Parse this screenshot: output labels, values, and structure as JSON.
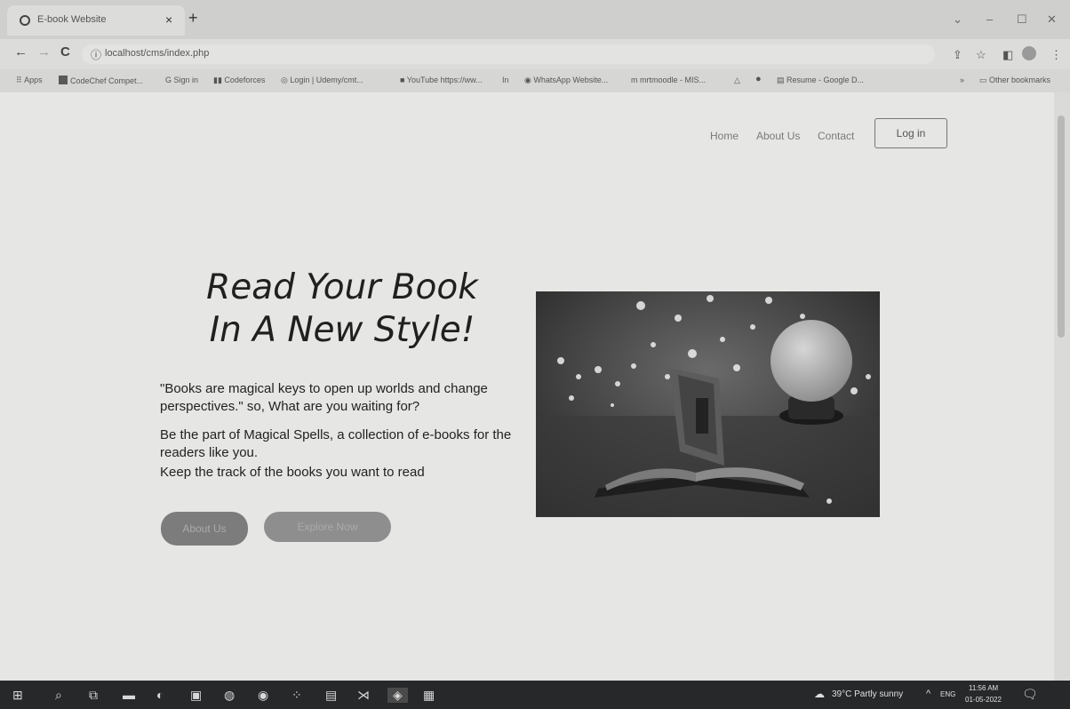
{
  "browser": {
    "tab_title": "E-book Website",
    "tab_close": "×",
    "new_tab": "+",
    "minimize": "–",
    "maximize": "☐",
    "close": "✕",
    "back": "←",
    "forward": "→",
    "reload": "C",
    "info_icon": "ⓘ",
    "url": "localhost/cms/index.php",
    "bookmarks": [
      {
        "icon": "apps-icon",
        "label": "Apps"
      },
      {
        "icon": "codechef-icon",
        "label": "CodeChef Compet..."
      },
      {
        "icon": "google-icon",
        "label": "Sign in"
      },
      {
        "icon": "codeforces-icon",
        "label": "Codeforces"
      },
      {
        "icon": "login-icon",
        "label": "Login | Udemy/cmt..."
      },
      {
        "icon": "youtube-icon",
        "label": "YouTube https://ww..."
      },
      {
        "icon": "link-icon",
        "label": "In"
      },
      {
        "icon": "whatsapp-icon",
        "label": "WhatsApp Website..."
      },
      {
        "icon": "moodle-icon",
        "label": "mrtmoodle - MIS..."
      },
      {
        "icon": "drive-icon",
        "label": ""
      },
      {
        "icon": "github-icon",
        "label": ""
      },
      {
        "icon": "resume-icon",
        "label": "Resume - Google D..."
      }
    ],
    "other_bookmarks": "Other bookmarks"
  },
  "nav": {
    "home": "Home",
    "about": "About Us",
    "contact": "Contact",
    "login": "Log in"
  },
  "hero": {
    "headline_line1": "Read Your Book",
    "headline_line2": "In A New Style!",
    "quote": "\"Books are magical keys to open up worlds and change perspectives.\" so, What are you waiting for?",
    "desc1": "Be the part of Magical Spells, a collection of e-books for the readers like you.",
    "desc2": "Keep the track of the books you want to read",
    "about_btn": "About Us",
    "explore_btn": "Explore Now",
    "image_icon": "magic-book-crystal-ball-image"
  },
  "taskbar": {
    "weather": "39°C Partly sunny",
    "chevron": "^",
    "language": "ENG",
    "time": "11:56 AM",
    "date": "01-05-2022"
  }
}
